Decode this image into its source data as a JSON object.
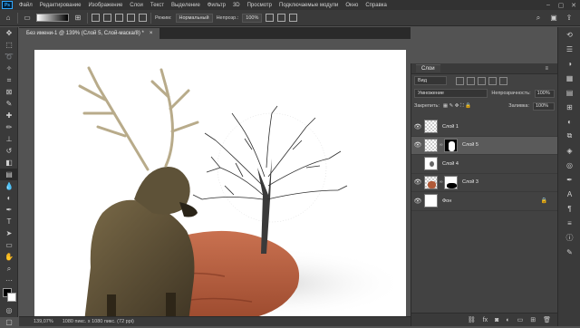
{
  "menu": {
    "logo": "Ps",
    "items": [
      "Файл",
      "Редактирование",
      "Изображение",
      "Слои",
      "Текст",
      "Выделение",
      "Фильтр",
      "3D",
      "Просмотр",
      "Подключаемые модули",
      "Окно",
      "Справка"
    ]
  },
  "options": {
    "mode_label": "Режим:",
    "mode_value": "Нормальный",
    "opacity_label": "Непрозр.:",
    "opacity_value": "100%"
  },
  "document": {
    "tab_title": "Без имени-1 @ 139% (Слой 5, Слой-маска/8) *",
    "tab_close": "×"
  },
  "status": {
    "zoom": "139,07%",
    "info": "1080 пикс. x 1080 пикс. (72 ppi)"
  },
  "layers_panel": {
    "title": "Слои",
    "filter_value": "Вид",
    "blend_mode": "Умножение",
    "opacity_label": "Непрозрачность:",
    "opacity_value": "100%",
    "lock_label": "Закрепить:",
    "fill_label": "Заливка:",
    "fill_value": "100%",
    "layers": [
      {
        "name": "Слой 1",
        "selected": false
      },
      {
        "name": "Слой 5",
        "selected": true
      },
      {
        "name": "Слой 4",
        "selected": false
      },
      {
        "name": "Слой 3",
        "selected": false
      },
      {
        "name": "Фон",
        "selected": false
      }
    ]
  },
  "colors": {
    "menubar": "#323232",
    "panel": "#424242",
    "selected_layer": "#5a5a5a",
    "canvas_bg": "#535353"
  }
}
